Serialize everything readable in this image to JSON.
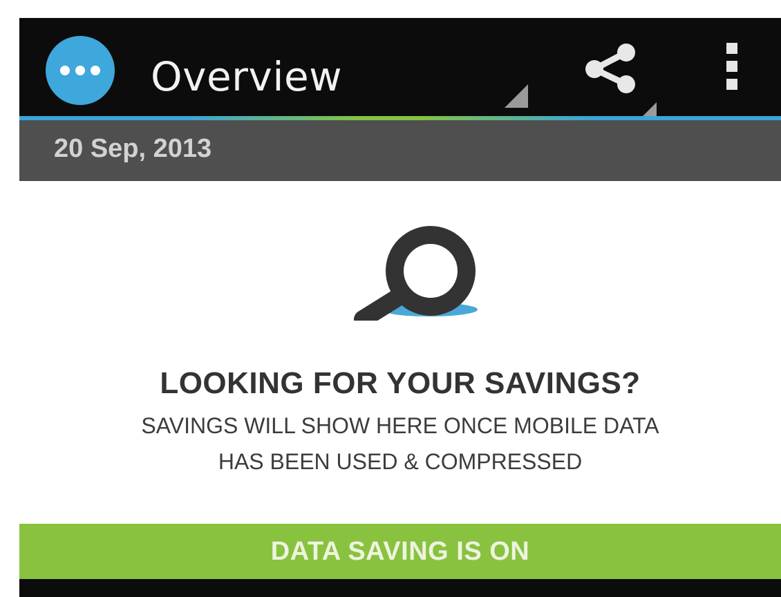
{
  "action_bar": {
    "title": "Overview",
    "app_icon": "more-dots-icon",
    "share_icon": "share-icon",
    "overflow_icon": "overflow-menu-icon",
    "accent_colors": [
      "#3aa6d8",
      "#86c440"
    ]
  },
  "date_bar": {
    "date": "20 Sep, 2013"
  },
  "empty_state": {
    "icon": "magnifier-icon",
    "heading": "LOOKING FOR YOUR SAVINGS?",
    "line1": "SAVINGS WILL SHOW HERE ONCE MOBILE DATA",
    "line2": "HAS BEEN USED & COMPRESSED"
  },
  "status": {
    "label": "DATA SAVING IS ON",
    "color": "#88c23f"
  }
}
